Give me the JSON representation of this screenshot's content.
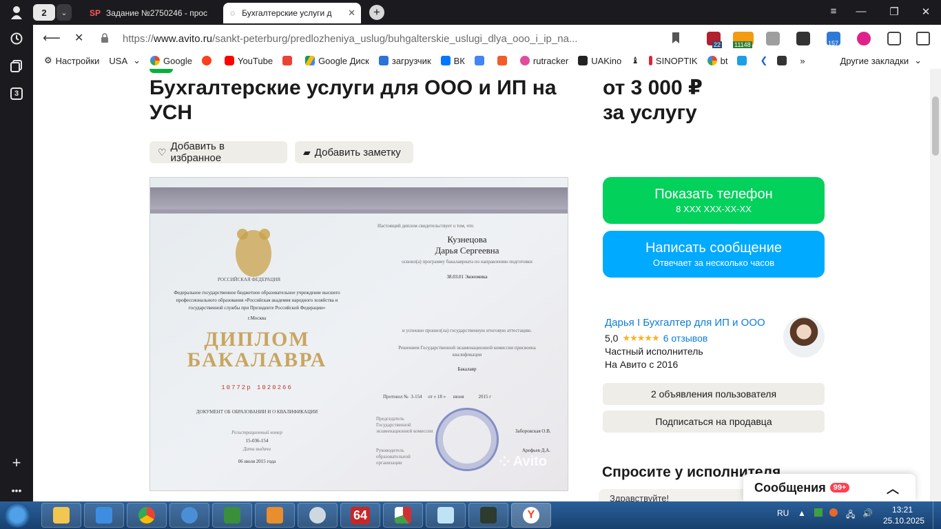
{
  "left_rail": {
    "workspace_count": "3"
  },
  "tabs": {
    "count": "2",
    "items": [
      {
        "label": "Задание №2750246 - прос",
        "favicon": "SP"
      },
      {
        "label": "Бухгалтерские услуги д"
      }
    ]
  },
  "address": {
    "url_prefix": "https://",
    "host": "www.avito.ru",
    "path": "/sankt-peterburg/predlozheniya_uslug/buhgalterskie_uslugi_dlya_ooo_i_ip_na..."
  },
  "extensions": {
    "badge_1": "22",
    "badge_2": "11148",
    "badge_3": "157"
  },
  "bookmarks": {
    "items": [
      "Настройки",
      "USA",
      "Google",
      "YouTube",
      "Google Диск",
      "загрузчик",
      "ВК",
      "rutracker",
      "UAKino",
      "SINOPTIK",
      "bt"
    ],
    "other": "Другие закладки"
  },
  "listing": {
    "title": "Бухгалтерские услуги для ООО и ИП на УСН",
    "price_line1": "от 3 000 ₽",
    "price_line2": "за услугу",
    "favorite_label": "Добавить в избранное",
    "note_label": "Добавить заметку"
  },
  "diploma": {
    "header_left": "РОССИЙСКАЯ ФЕДЕРАЦИЯ",
    "institution": "Федеральное государственное бюджетное образовательное учреждение высшего профессионального образования «Российская академия народного хозяйства и государственной службы при Президенте Российской Федерации»",
    "city": "г.Москва",
    "title_1": "ДИПЛОМ",
    "title_2": "БАКАЛАВРА",
    "serial": "10772р 1020266",
    "doc_type": "ДОКУМЕНТ ОБ ОБРАЗОВАНИИ И О КВАЛИФИКАЦИИ",
    "reg_label": "Регистрационный номер",
    "reg_number": "15-036-154",
    "date_label": "Дата выдачи",
    "date_issued": "06 июля 2015 года",
    "intro": "Настоящий диплом свидетельствует о том, что",
    "surname": "Кузнецова",
    "name": "Дарья Сергеевна",
    "program_text": "освоил(а) программу бакалавриата по направлению подготовки",
    "program": "38.03.01 Экономика",
    "attest_text": "и успешно прошел(ла) государственную итоговую аттестацию.",
    "commission_text": "Решением Государственной экзаменационной комиссии присвоена квалификация",
    "qualification": "Бакалавр",
    "protocol": "Протокол №  3-154     от « 18 »      июня            2015 г",
    "chair_label": "Председатель Государственной экзаменационной комиссии",
    "chair_name": "Заборовская О.В.",
    "head_label": "Руководитель образовательной организации",
    "head_name": "Арефьев Д.А.",
    "watermark": "Avito"
  },
  "actions": {
    "phone_label": "Показать телефон",
    "phone_masked": "8 XXX XXX-XX-XX",
    "message_label": "Написать сообщение",
    "message_sub": "Отвечает за несколько часов"
  },
  "seller": {
    "name": "Дарья I Бухгалтер для ИП и ООО",
    "rating": "5,0",
    "stars": "★★★★★",
    "reviews": "6 отзывов",
    "type": "Частный исполнитель",
    "since": "На Авито с 2016",
    "ads_button": "2 объявления пользователя",
    "subscribe_button": "Подписаться на продавца"
  },
  "ask": {
    "title": "Спросите у исполнителя",
    "input_value": "Здравствуйте!"
  },
  "messages": {
    "label": "Сообщения",
    "badge": "99+"
  },
  "taskbar": {
    "lang": "RU",
    "time": "13:21",
    "date": "25.10.2025",
    "app_64": "64"
  },
  "colors": {
    "green": "#02d15c",
    "blue": "#00aaff",
    "link": "#0a7cd9",
    "star": "#ffb021"
  }
}
